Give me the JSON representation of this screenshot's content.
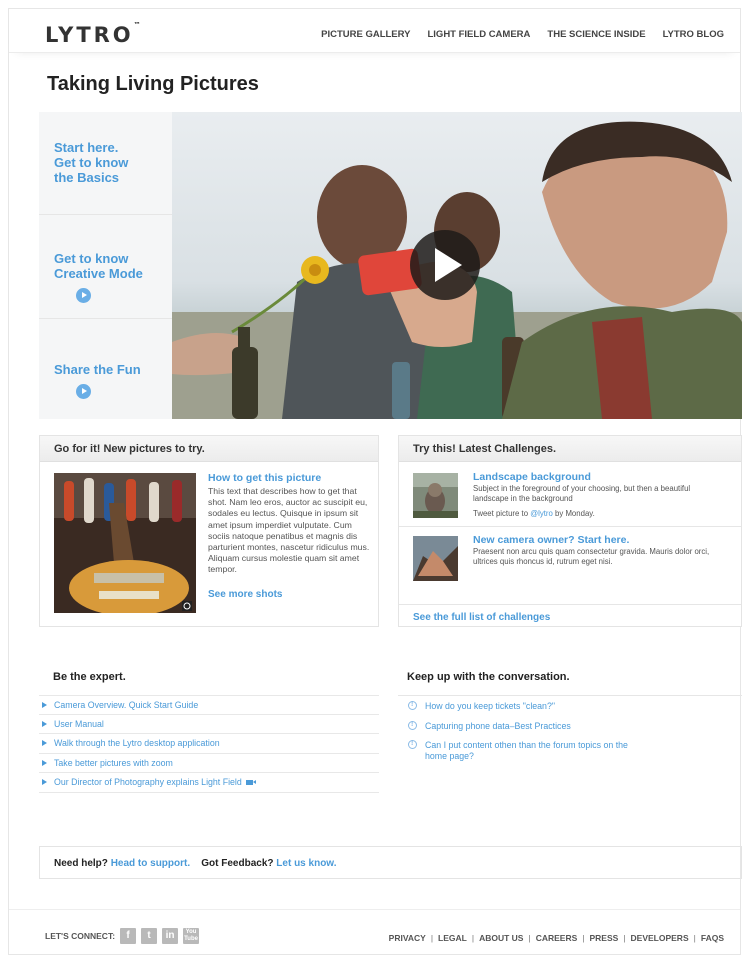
{
  "header": {
    "logo": "LYTRO",
    "logo_tm": "™",
    "nav": [
      "PICTURE GALLERY",
      "LIGHT FIELD CAMERA",
      "THE SCIENCE INSIDE",
      "LYTRO BLOG"
    ]
  },
  "page_title": "Taking Living Pictures",
  "hero": {
    "side": [
      {
        "label": "Start here.\nGet to know\nthe Basics"
      },
      {
        "label": "Get to know\nCreative Mode"
      },
      {
        "label": "Share the Fun"
      }
    ]
  },
  "pictures": {
    "heading": "Go for it! New pictures to try.",
    "feature_title": "How to get this picture",
    "feature_text": "This text that describes how to get that shot. Nam leo eros, auctor ac suscipit eu, sodales eu lectus. Quisque in ipsum sit amet ipsum imperdiet vulputate. Cum sociis natoque penatibus et magnis dis parturient montes, nascetur ridiculus mus. Aliquam cursus molestie quam sit amet tempor.",
    "see_more": "See more shots"
  },
  "challenges": {
    "heading": "Try this! Latest Challenges.",
    "items": [
      {
        "title": "Landscape background",
        "desc": "Subject in the foreground of your choosing, but then a beautiful landscape in the background",
        "tweet_prefix": "Tweet picture to ",
        "tweet_handle": "@lytro",
        "tweet_suffix": " by Monday."
      },
      {
        "title": "New camera owner? Start here.",
        "desc": "Praesent non arcu quis quam consectetur gravida. Mauris dolor orci, ultrices quis rhoncus id, rutrum eget nisi."
      }
    ],
    "full_list": "See the full list of challenges"
  },
  "expert": {
    "heading": "Be the expert.",
    "links": [
      "Camera Overview. Quick Start Guide",
      "User Manual",
      "Walk through the Lytro desktop application",
      "Take better pictures with zoom",
      "Our Director of Photography explains Light Field"
    ]
  },
  "conversation": {
    "heading": "Keep up with the conversation.",
    "links": [
      "How do you keep tickets \"clean?\"",
      "Capturing phone data–Best Practices",
      "Can I put content othen than the forum topics on the home page?"
    ]
  },
  "help": {
    "need_help": "Need help?",
    "support_link": "Head to support.",
    "feedback": "Got Feedback?",
    "feedback_link": "Let us know."
  },
  "footer": {
    "connect": "LET'S CONNECT:",
    "social": [
      {
        "icon": "facebook-icon",
        "glyph": "f"
      },
      {
        "icon": "twitter-icon",
        "glyph": "t"
      },
      {
        "icon": "linkedin-icon",
        "glyph": "in"
      },
      {
        "icon": "youtube-icon",
        "glyph": "You Tube"
      }
    ],
    "links": [
      "PRIVACY",
      "LEGAL",
      "ABOUT US",
      "CAREERS",
      "PRESS",
      "DEVELOPERS",
      "FAQS"
    ],
    "separator": "|"
  },
  "colors": {
    "accent": "#4a9ad8",
    "text": "#333333",
    "border": "#e4e4e4"
  }
}
